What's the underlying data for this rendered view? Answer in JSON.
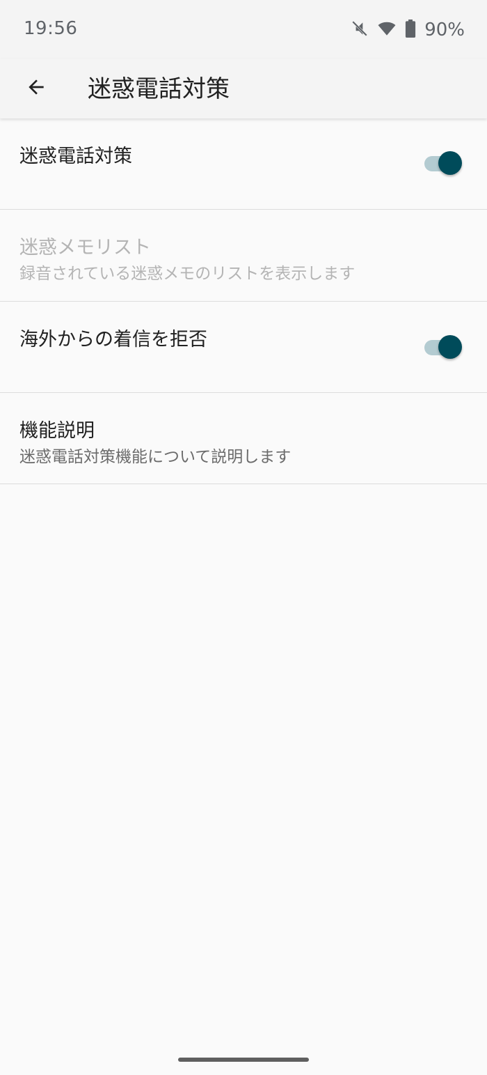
{
  "status_bar": {
    "time": "19:56",
    "battery": "90%",
    "icons": [
      "mute-icon",
      "wifi-icon",
      "battery-icon"
    ]
  },
  "app_bar": {
    "title": "迷惑電話対策",
    "back_icon": "arrow-back-icon"
  },
  "items": [
    {
      "title": "迷惑電話対策",
      "summary": "",
      "switch_on": true,
      "enabled": true
    },
    {
      "title": "迷惑メモリスト",
      "summary": "録音されている迷惑メモのリストを表示します",
      "enabled": false
    },
    {
      "title": "海外からの着信を拒否",
      "summary": "",
      "switch_on": true,
      "enabled": true
    },
    {
      "title": "機能説明",
      "summary": "迷惑電話対策機能について説明します",
      "enabled": true
    }
  ],
  "colors": {
    "accent": "#004b5a",
    "track": "#b3cbd1",
    "background": "#fafafa",
    "bar": "#f4f4f4"
  }
}
